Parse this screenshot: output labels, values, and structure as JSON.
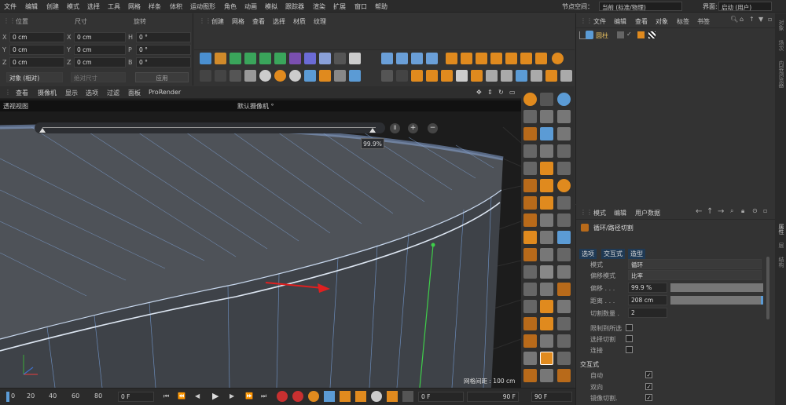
{
  "menubar": {
    "items": [
      "文件",
      "编辑",
      "创建",
      "模式",
      "选择",
      "工具",
      "网格",
      "样条",
      "体积",
      "运动图形",
      "角色",
      "动画",
      "模拟",
      "跟踪器",
      "渲染",
      "扩展",
      "窗口",
      "帮助"
    ],
    "node_space_label": "节点空间：",
    "node_space_value": "当前 (标准/物理)",
    "layout_label": "界面:",
    "layout_value": "启动 (用户)"
  },
  "coords": {
    "headers": {
      "position": "位置",
      "size": "尺寸",
      "rotation": "旋转"
    },
    "rows": [
      {
        "axis": "X",
        "pos": "0 cm",
        "size_axis": "X",
        "size": "0 cm",
        "rot_axis": "H",
        "rot": "0 °"
      },
      {
        "axis": "Y",
        "pos": "0 cm",
        "size_axis": "Y",
        "size": "0 cm",
        "rot_axis": "P",
        "rot": "0 °"
      },
      {
        "axis": "Z",
        "pos": "0 cm",
        "size_axis": "Z",
        "size": "0 cm",
        "rot_axis": "B",
        "rot": "0 °"
      }
    ],
    "mode_value": "对象 (相对)",
    "size_mode_value": "绝对尺寸",
    "apply_label": "应用"
  },
  "toolbar_menu": [
    "创建",
    "网格",
    "查看",
    "选择",
    "材质",
    "纹理"
  ],
  "viewport": {
    "menu": [
      "查看",
      "摄像机",
      "显示",
      "选项",
      "过滤",
      "面板",
      "ProRender"
    ],
    "title": "透视视图",
    "camera": "默认摄像机 °",
    "slider_value": "99.9%",
    "grid_spacing": "网格间距 : 100 cm"
  },
  "objects": {
    "menu": [
      "文件",
      "编辑",
      "查看",
      "对象",
      "标签",
      "书签"
    ],
    "items": [
      {
        "name": "圆柱"
      }
    ]
  },
  "attributes": {
    "menu": [
      "模式",
      "编辑",
      "用户数据"
    ],
    "tool_title": "循环/路径切割",
    "tabs": [
      "选项",
      "交互式",
      "造型"
    ],
    "props": [
      {
        "label": "模式",
        "value": "循环"
      },
      {
        "label": "偏移模式",
        "value": "比率"
      },
      {
        "label": "偏移 . . .",
        "value": "99.9 %",
        "fill": 0.999
      },
      {
        "label": "距离 . . .",
        "value": "208 cm",
        "fill": 1.0
      },
      {
        "label": "切割数量 .",
        "value": "2"
      }
    ],
    "checks": [
      {
        "label": "限制到所选",
        "checked": false
      },
      {
        "label": "选择切割",
        "checked": false
      },
      {
        "label": "连接",
        "checked": false
      }
    ],
    "section": "交互式",
    "checks2": [
      {
        "label": "自动",
        "checked": true
      },
      {
        "label": "双向",
        "checked": true
      },
      {
        "label": "镜像切割.",
        "checked": true
      }
    ]
  },
  "right_tabs_top": [
    "对象",
    "场次",
    "内容浏览器"
  ],
  "right_tabs_bottom": [
    "属性",
    "层",
    "结构"
  ],
  "timeline": {
    "ticks": [
      "0",
      "20",
      "40",
      "60",
      "80"
    ],
    "start": "0 F",
    "current": "0 F",
    "end1": "90 F",
    "end2": "90 F"
  },
  "colors": {
    "accent": "#5b9bd5",
    "highlight": "#e07b00",
    "panel": "#333333"
  }
}
